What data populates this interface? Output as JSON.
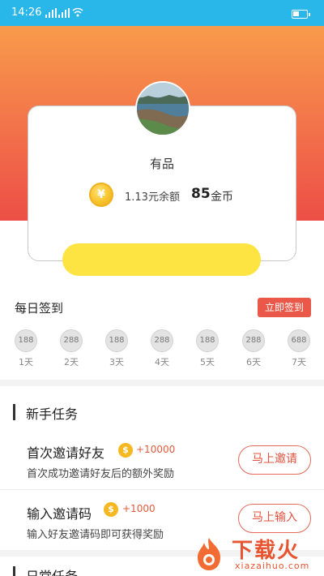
{
  "status_bar": {
    "time": "14:26"
  },
  "profile": {
    "username": "有品",
    "balance": "1.13元余额",
    "gold_amount": "85",
    "gold_unit": "金币",
    "coin_symbol": "¥"
  },
  "signin": {
    "title": "每日签到",
    "button": "立即签到",
    "days": [
      {
        "reward": "188",
        "label": "1天"
      },
      {
        "reward": "288",
        "label": "2天"
      },
      {
        "reward": "188",
        "label": "3天"
      },
      {
        "reward": "288",
        "label": "4天"
      },
      {
        "reward": "188",
        "label": "5天"
      },
      {
        "reward": "288",
        "label": "6天"
      },
      {
        "reward": "688",
        "label": "7天"
      }
    ]
  },
  "newbie": {
    "title": "新手任务",
    "tasks": [
      {
        "title": "首次邀请好友",
        "coin_symbol": "$",
        "reward": "+10000",
        "desc": "首次成功邀请好友后的额外奖励",
        "button": "马上邀请"
      },
      {
        "title": "输入邀请码",
        "coin_symbol": "$",
        "reward": "+1000",
        "desc": "输入好友邀请码即可获得奖励",
        "button": "马上输入"
      }
    ]
  },
  "daily": {
    "title": "日常任务"
  },
  "watermark": {
    "text": "下载火",
    "url": "xiazaihuo.com"
  },
  "colors": {
    "status_bar": "#29b6e8",
    "hero_top": "#f89b4b",
    "hero_bottom": "#ec4f46",
    "accent_red": "#e95848",
    "yellow_button": "#fde443",
    "coin": "#f6b822"
  }
}
